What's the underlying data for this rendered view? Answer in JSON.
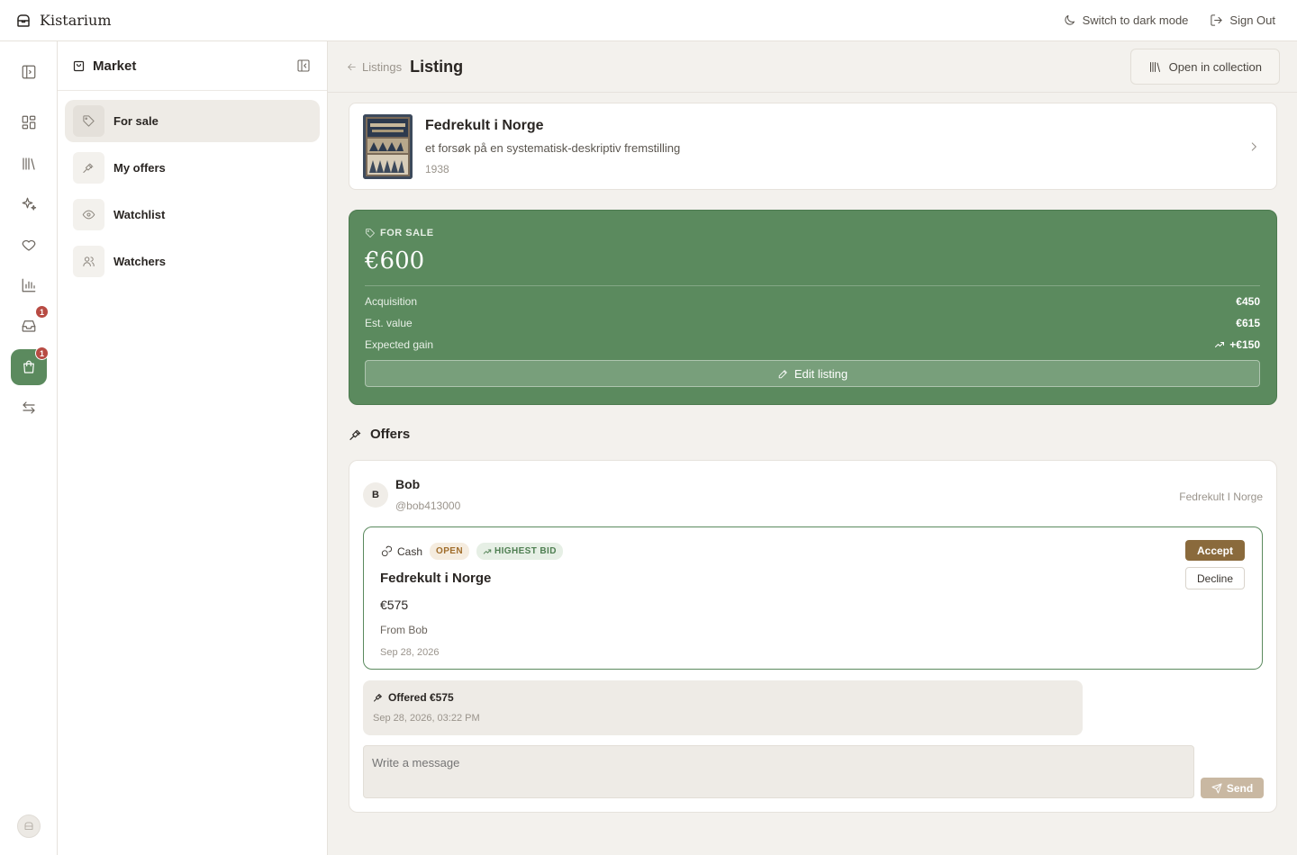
{
  "app": {
    "name": "Kistarium",
    "logo_icon": "archive-box-icon"
  },
  "topbar": {
    "dark_mode_label": "Switch to dark mode",
    "sign_out_label": "Sign Out"
  },
  "rail": {
    "items": [
      {
        "name": "sidebar-toggle",
        "icon": "panel-left-icon"
      },
      {
        "name": "dashboard",
        "icon": "grid-icon"
      },
      {
        "name": "collection",
        "icon": "library-icon"
      },
      {
        "name": "discover",
        "icon": "sparkles-icon"
      },
      {
        "name": "favorites",
        "icon": "heart-icon"
      },
      {
        "name": "stats",
        "icon": "chart-icon"
      },
      {
        "name": "inbox",
        "icon": "inbox-icon",
        "badge": "1"
      },
      {
        "name": "market",
        "icon": "shopping-bag-icon",
        "badge": "1",
        "active": true
      },
      {
        "name": "trades",
        "icon": "arrows-swap-icon"
      }
    ]
  },
  "panel": {
    "title": "Market",
    "items": [
      {
        "label": "For sale",
        "icon": "tag-icon",
        "active": true
      },
      {
        "label": "My offers",
        "icon": "gavel-icon"
      },
      {
        "label": "Watchlist",
        "icon": "eye-icon"
      },
      {
        "label": "Watchers",
        "icon": "users-icon"
      }
    ]
  },
  "header": {
    "breadcrumb": "Listings",
    "title": "Listing",
    "open_collection_label": "Open in collection"
  },
  "item": {
    "title": "Fedrekult i Norge",
    "subtitle": "et forsøk på en systematisk-deskriptiv fremstilling",
    "year": "1938"
  },
  "sale": {
    "label": "FOR SALE",
    "price": "€600",
    "rows": [
      {
        "label": "Acquisition",
        "value": "€450"
      },
      {
        "label": "Est. value",
        "value": "€615"
      },
      {
        "label": "Expected gain",
        "value": "+€150"
      }
    ],
    "edit_label": "Edit listing",
    "color": "#5b8a5e"
  },
  "offers": {
    "heading": "Offers",
    "user": {
      "initial": "B",
      "name": "Bob",
      "handle": "@bob413000",
      "ref": "Fedrekult I Norge"
    },
    "offer": {
      "type": "Cash",
      "status": "OPEN",
      "flag": "HIGHEST BID",
      "title": "Fedrekult i Norge",
      "amount": "€575",
      "from": "From Bob",
      "date": "Sep 28, 2026",
      "accept_label": "Accept",
      "decline_label": "Decline"
    },
    "message": {
      "title": "Offered €575",
      "date": "Sep 28, 2026, 03:22 PM"
    },
    "compose": {
      "placeholder": "Write a message",
      "send_label": "Send"
    }
  },
  "colors": {
    "accent_green": "#5b8a5e",
    "accent_brown": "#8a6a3c",
    "badge_red": "#b84b43"
  }
}
